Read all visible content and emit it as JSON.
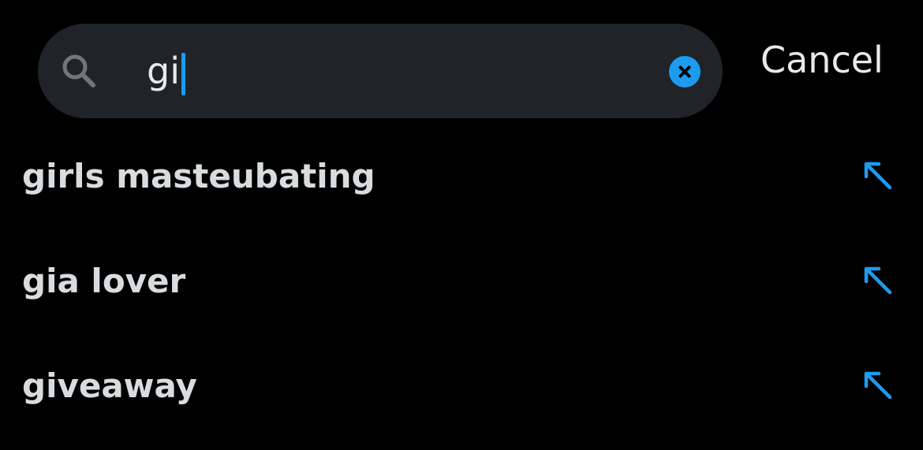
{
  "colors": {
    "background": "#000000",
    "search_bar_bg": "#202327",
    "accent": "#1d9bf0",
    "text_primary": "#e7e9ea",
    "suggestion_text": "#d9dcde",
    "icon_gray": "#71767b"
  },
  "search": {
    "value": "gi",
    "icon": "search-icon",
    "clear_icon": "close-circle-icon"
  },
  "cancel_label": "Cancel",
  "suggestions": [
    {
      "label": "girls masteubating",
      "icon": "arrow-up-left-icon"
    },
    {
      "label": "gia lover",
      "icon": "arrow-up-left-icon"
    },
    {
      "label": "giveaway",
      "icon": "arrow-up-left-icon"
    }
  ]
}
